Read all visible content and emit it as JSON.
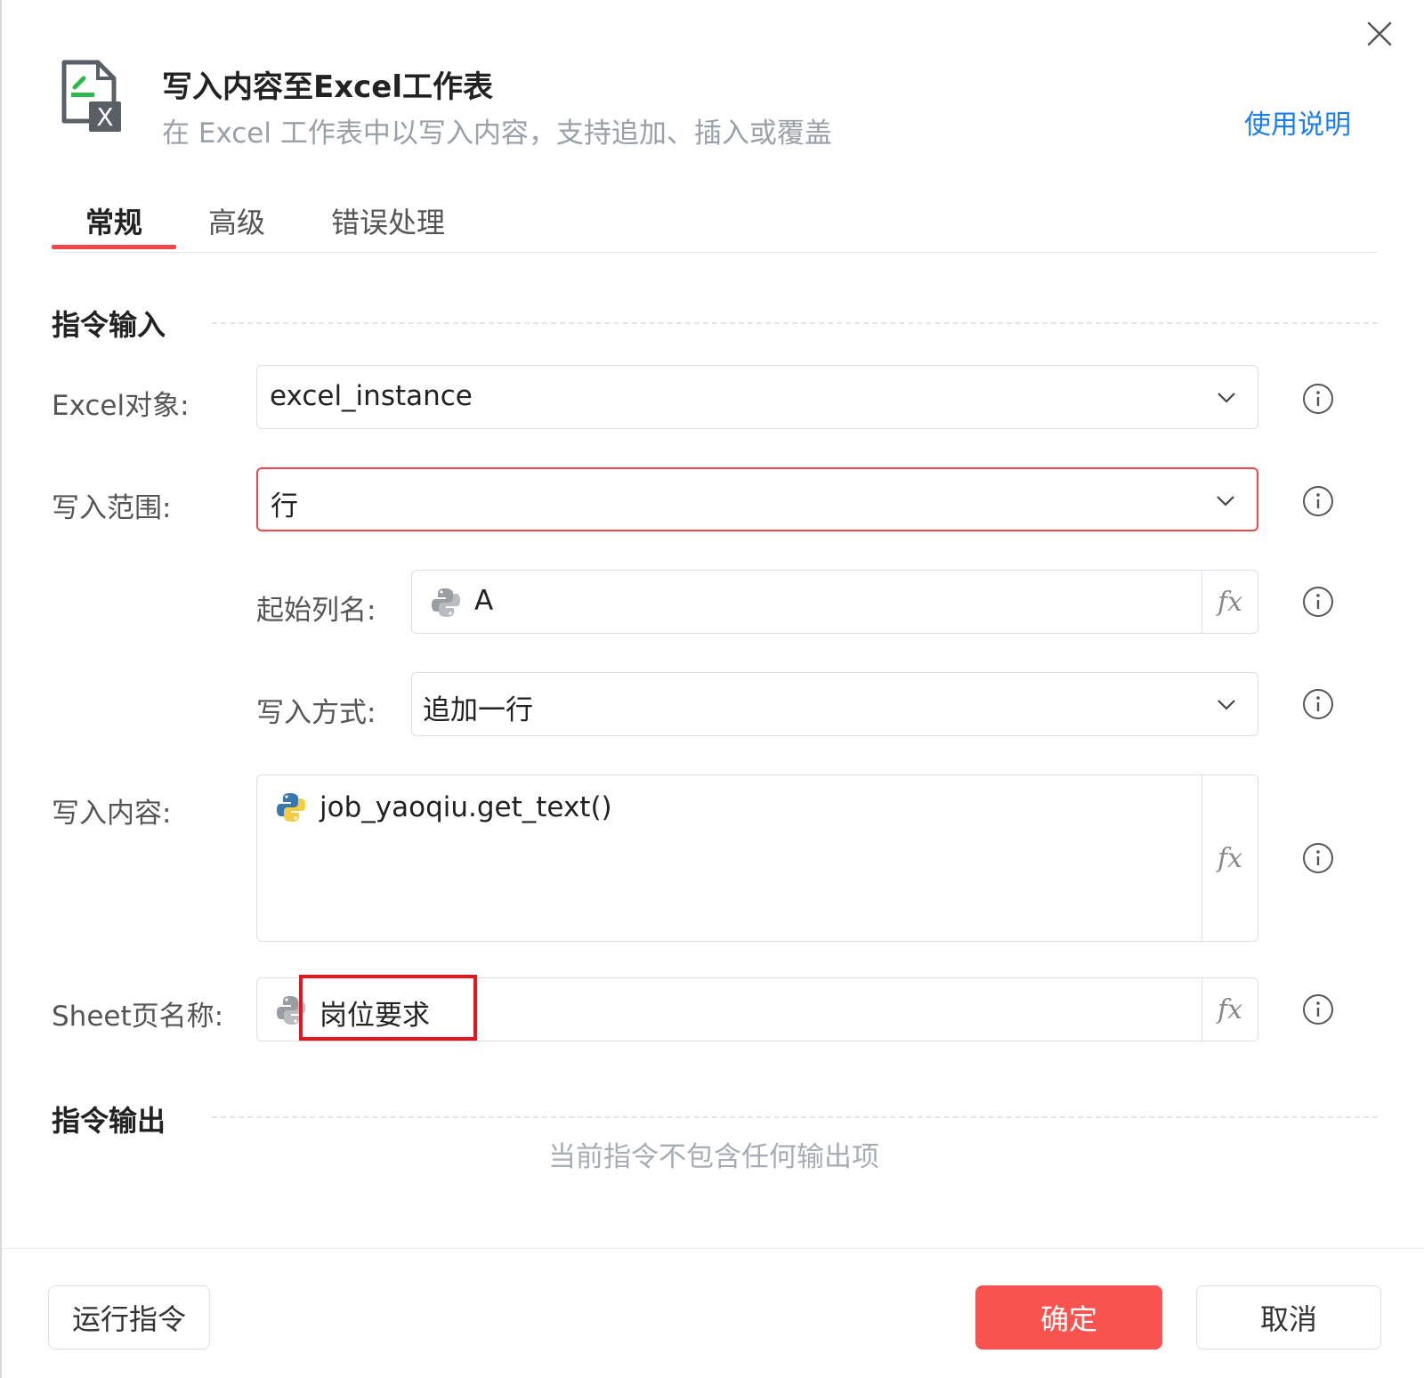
{
  "header": {
    "title": "写入内容至Excel工作表",
    "subtitle": "在 Excel 工作表中以写入内容，支持追加、插入或覆盖",
    "help_link": "使用说明"
  },
  "tabs": [
    {
      "label": "常规",
      "active": true
    },
    {
      "label": "高级",
      "active": false
    },
    {
      "label": "错误处理",
      "active": false
    }
  ],
  "sections": {
    "input_title": "指令输入",
    "output_title": "指令输出",
    "output_empty": "当前指令不包含任何输出项"
  },
  "form": {
    "excel_object": {
      "label": "Excel对象:",
      "value": "excel_instance"
    },
    "write_range": {
      "label": "写入范围:",
      "value": "行"
    },
    "start_column": {
      "label": "起始列名:",
      "value": "A"
    },
    "write_mode": {
      "label": "写入方式:",
      "value": "追加一行"
    },
    "write_content": {
      "label": "写入内容:",
      "value": "job_yaoqiu.get_text()"
    },
    "sheet_name": {
      "label": "Sheet页名称:",
      "value": "岗位要求"
    },
    "fx_label": "fx"
  },
  "footer": {
    "run_label": "运行指令",
    "ok_label": "确定",
    "cancel_label": "取消"
  },
  "colors": {
    "accent": "#f0474b",
    "primary_button": "#f8534f",
    "link": "#1a7cf0",
    "highlight": "#e8141b"
  },
  "icons": {
    "app": "excel-write-icon",
    "close": "close-icon",
    "dropdown": "chevron-down-icon",
    "python": "python-icon",
    "info": "info-icon"
  }
}
